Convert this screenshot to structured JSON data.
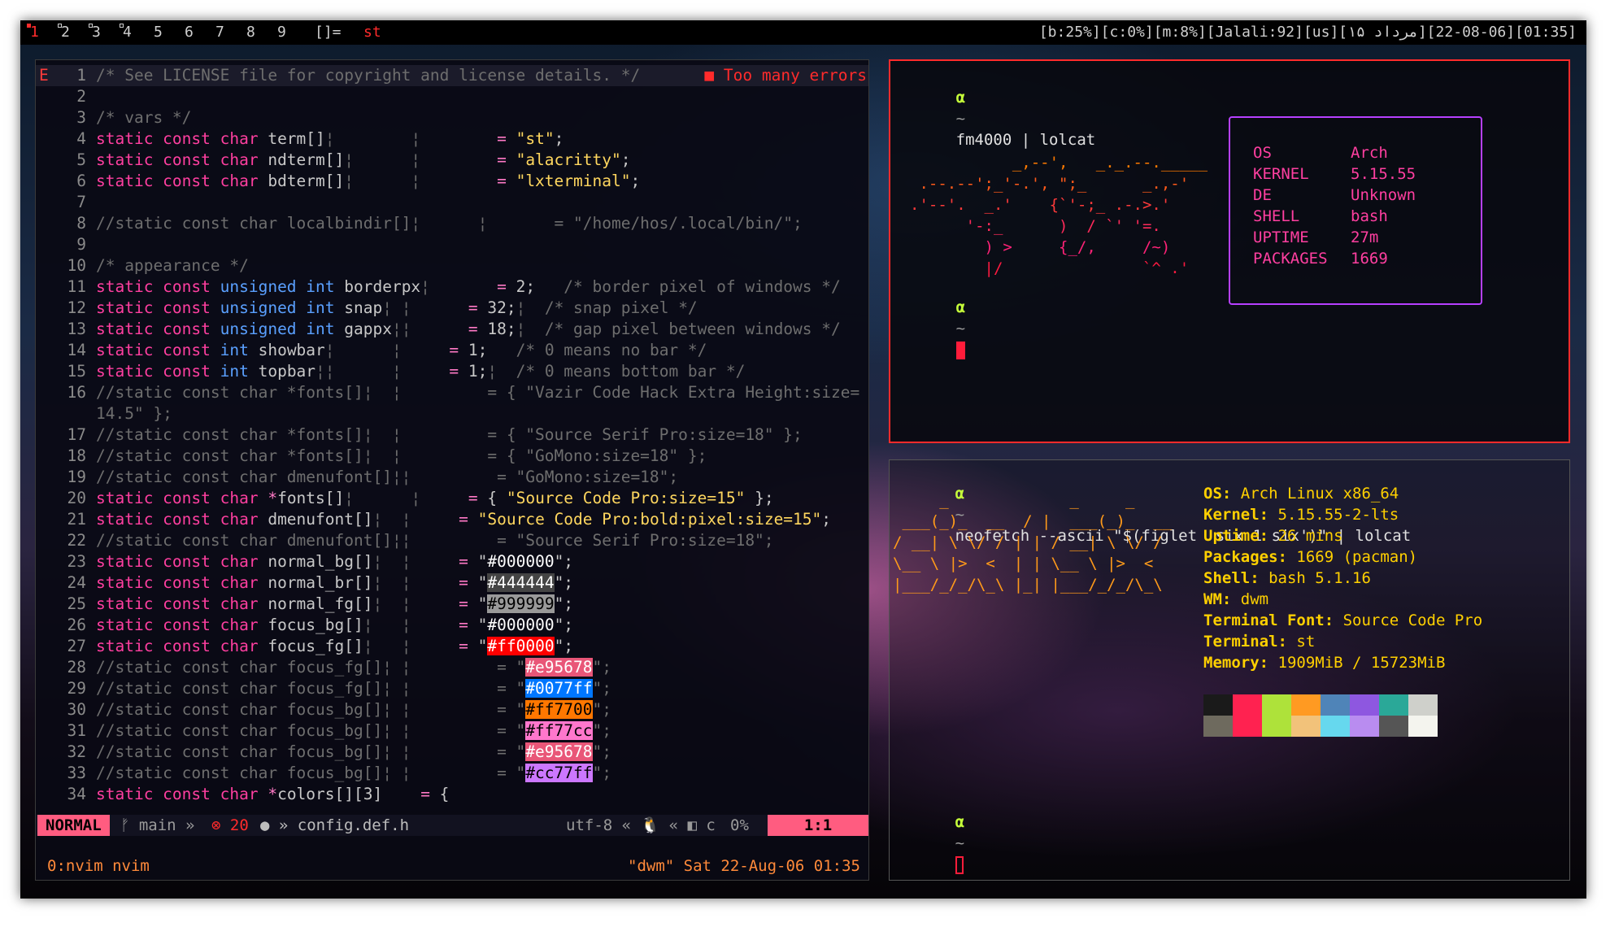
{
  "bar": {
    "tags": [
      "1",
      "2",
      "3",
      "4",
      "5",
      "6",
      "7",
      "8",
      "9"
    ],
    "layout": "[]=",
    "window_title": "st",
    "status": "[b:25%][c:0%][m:8%][Jalali:92][us][۱۵ مرداد][06-08-22][01:35]"
  },
  "vim": {
    "sign": "E",
    "error_text": "■ Too many errors",
    "lines": [
      {
        "n": "1",
        "parts": [
          [
            "cm",
            "/* See LICENSE file for copyright and license details. */"
          ]
        ]
      },
      {
        "n": "2",
        "parts": []
      },
      {
        "n": "3",
        "parts": [
          [
            "cm",
            "/* vars */"
          ]
        ]
      },
      {
        "n": "4",
        "parts": [
          [
            "kw",
            "static const char "
          ],
          [
            "",
            "term[]"
          ],
          [
            "cm",
            "¦        ¦        "
          ],
          [
            "op",
            "= "
          ],
          [
            "str",
            "\"st\""
          ],
          [
            "",
            "; "
          ]
        ]
      },
      {
        "n": "5",
        "parts": [
          [
            "kw",
            "static const char "
          ],
          [
            "",
            "ndterm[]"
          ],
          [
            "cm",
            "¦      ¦        "
          ],
          [
            "op",
            "= "
          ],
          [
            "str",
            "\"alacritty\""
          ],
          [
            "",
            ";"
          ]
        ]
      },
      {
        "n": "6",
        "parts": [
          [
            "kw",
            "static const char "
          ],
          [
            "",
            "bdterm[]"
          ],
          [
            "cm",
            "¦      ¦        "
          ],
          [
            "op",
            "= "
          ],
          [
            "str",
            "\"lxterminal\""
          ],
          [
            "",
            ";"
          ]
        ]
      },
      {
        "n": "7",
        "parts": []
      },
      {
        "n": "8",
        "parts": [
          [
            "cm",
            "//static const char localbindir[]¦      ¦       = \"/home/hos/.local/bin/\";"
          ]
        ]
      },
      {
        "n": "9",
        "parts": []
      },
      {
        "n": "10",
        "parts": [
          [
            "cm",
            "/* appearance */"
          ]
        ]
      },
      {
        "n": "11",
        "parts": [
          [
            "kw",
            "static const "
          ],
          [
            "kt",
            "unsigned int "
          ],
          [
            "",
            "borderpx"
          ],
          [
            "cm",
            "¦       "
          ],
          [
            "op",
            "= "
          ],
          [
            "",
            "2;   "
          ],
          [
            "cm",
            "/* border pixel of windows */"
          ]
        ]
      },
      {
        "n": "12",
        "parts": [
          [
            "kw",
            "static const "
          ],
          [
            "kt",
            "unsigned int "
          ],
          [
            "",
            "snap"
          ],
          [
            "cm",
            "¦ ¦      "
          ],
          [
            "op",
            "= "
          ],
          [
            "",
            "32;"
          ],
          [
            "cm",
            "¦  /* snap pixel */"
          ]
        ]
      },
      {
        "n": "13",
        "parts": [
          [
            "kw",
            "static const "
          ],
          [
            "kt",
            "unsigned int "
          ],
          [
            "",
            "gappx"
          ],
          [
            "cm",
            "¦¦      "
          ],
          [
            "op",
            "= "
          ],
          [
            "",
            "18;"
          ],
          [
            "cm",
            "¦  /* gap pixel between windows */"
          ]
        ]
      },
      {
        "n": "14",
        "parts": [
          [
            "kw",
            "static const "
          ],
          [
            "kt",
            "int "
          ],
          [
            "",
            "showbar"
          ],
          [
            "cm",
            "¦      ¦     "
          ],
          [
            "op",
            "= "
          ],
          [
            "",
            "1;   "
          ],
          [
            "cm",
            "/* 0 means no bar */"
          ]
        ]
      },
      {
        "n": "15",
        "parts": [
          [
            "kw",
            "static const "
          ],
          [
            "kt",
            "int "
          ],
          [
            "",
            "topbar"
          ],
          [
            "cm",
            "¦¦      ¦     "
          ],
          [
            "op",
            "= "
          ],
          [
            "",
            "1;"
          ],
          [
            "cm",
            "¦  /* 0 means bottom bar */"
          ]
        ]
      },
      {
        "n": "16",
        "parts": [
          [
            "cm",
            "//static const char *fonts[]¦  ¦         = { \"Vazir Code Hack Extra Height:size="
          ]
        ]
      },
      {
        "n": "",
        "parts": [
          [
            "cm",
            "14.5\" };"
          ]
        ]
      },
      {
        "n": "17",
        "parts": [
          [
            "cm",
            "//static const char *fonts[]¦  ¦         = { \"Source Serif Pro:size=18\" };"
          ]
        ]
      },
      {
        "n": "18",
        "parts": [
          [
            "cm",
            "//static const char *fonts[]¦  ¦         = { \"GoMono:size=18\" };"
          ]
        ]
      },
      {
        "n": "19",
        "parts": [
          [
            "cm",
            "//static const char dmenufont[]¦¦         = \"GoMono:size=18\";"
          ]
        ]
      },
      {
        "n": "20",
        "parts": [
          [
            "kw",
            "static const char "
          ],
          [
            "op",
            "*"
          ],
          [
            "",
            "fonts[]"
          ],
          [
            "cm",
            "¦      ¦     "
          ],
          [
            "op",
            "= "
          ],
          [
            "",
            "{ "
          ],
          [
            "str",
            "\"Source Code Pro:size=15\""
          ],
          [
            "",
            " };"
          ]
        ]
      },
      {
        "n": "21",
        "parts": [
          [
            "kw",
            "static const char "
          ],
          [
            "",
            "dmenufont[]"
          ],
          [
            "cm",
            "¦  ¦     "
          ],
          [
            "op",
            "= "
          ],
          [
            "str",
            "\"Source Code Pro:bold:pixel:size=15\""
          ],
          [
            "",
            ";"
          ]
        ]
      },
      {
        "n": "22",
        "parts": [
          [
            "cm",
            "//static const char dmenufont[]¦¦         = \"Source Serif Pro:size=18\";"
          ]
        ]
      },
      {
        "n": "23",
        "parts": [
          [
            "kw",
            "static const char "
          ],
          [
            "",
            "normal_bg[]"
          ],
          [
            "cm",
            "¦  ¦     "
          ],
          [
            "op",
            "= "
          ],
          [
            "",
            "\""
          ],
          [
            "swatch",
            "#000000"
          ],
          [
            "",
            "\";"
          ]
        ]
      },
      {
        "n": "24",
        "parts": [
          [
            "kw",
            "static const char "
          ],
          [
            "",
            "normal_br[]"
          ],
          [
            "cm",
            "¦  ¦     "
          ],
          [
            "op",
            "= "
          ],
          [
            "",
            "\""
          ],
          [
            "swatch",
            "#444444"
          ],
          [
            "",
            "\";"
          ]
        ]
      },
      {
        "n": "25",
        "parts": [
          [
            "kw",
            "static const char "
          ],
          [
            "",
            "normal_fg[]"
          ],
          [
            "cm",
            "¦  ¦     "
          ],
          [
            "op",
            "= "
          ],
          [
            "",
            "\""
          ],
          [
            "swatch",
            "#999999"
          ],
          [
            "",
            "\";"
          ]
        ]
      },
      {
        "n": "26",
        "parts": [
          [
            "kw",
            "static const char "
          ],
          [
            "",
            "focus_bg[]"
          ],
          [
            "cm",
            "¦   ¦     "
          ],
          [
            "op",
            "= "
          ],
          [
            "",
            "\""
          ],
          [
            "swatch",
            "#000000"
          ],
          [
            "",
            "\";"
          ]
        ]
      },
      {
        "n": "27",
        "parts": [
          [
            "kw",
            "static const char "
          ],
          [
            "",
            "focus_fg[]"
          ],
          [
            "cm",
            "¦   ¦     "
          ],
          [
            "op",
            "= "
          ],
          [
            "",
            "\""
          ],
          [
            "swatch",
            "#ff0000"
          ],
          [
            "",
            "\";"
          ]
        ]
      },
      {
        "n": "28",
        "parts": [
          [
            "cm",
            "//static const char focus_fg[]¦ ¦         = \""
          ],
          [
            "swatch",
            "#e95678"
          ],
          [
            "cm",
            "\";"
          ]
        ]
      },
      {
        "n": "29",
        "parts": [
          [
            "cm",
            "//static const char focus_fg[]¦ ¦         = \""
          ],
          [
            "swatch",
            "#0077ff"
          ],
          [
            "cm",
            "\";"
          ]
        ]
      },
      {
        "n": "30",
        "parts": [
          [
            "cm",
            "//static const char focus_bg[]¦ ¦         = \""
          ],
          [
            "swatch",
            "#ff7700"
          ],
          [
            "cm",
            "\";"
          ]
        ]
      },
      {
        "n": "31",
        "parts": [
          [
            "cm",
            "//static const char focus_bg[]¦ ¦         = \""
          ],
          [
            "swatch",
            "#ff77cc"
          ],
          [
            "cm",
            "\";"
          ]
        ]
      },
      {
        "n": "32",
        "parts": [
          [
            "cm",
            "//static const char focus_bg[]¦ ¦         = \""
          ],
          [
            "swatch",
            "#e95678"
          ],
          [
            "cm",
            "\";"
          ]
        ]
      },
      {
        "n": "33",
        "parts": [
          [
            "cm",
            "//static const char focus_bg[]¦ ¦         = \""
          ],
          [
            "swatch",
            "#cc77ff"
          ],
          [
            "cm",
            "\";"
          ]
        ]
      },
      {
        "n": "34",
        "parts": [
          [
            "kw",
            "static const char "
          ],
          [
            "op",
            "*"
          ],
          [
            "",
            "colors[][3]    "
          ],
          [
            "op",
            "= "
          ],
          [
            "",
            "{"
          ]
        ]
      }
    ],
    "swatch_colors": {
      "#000000": [
        "#000000",
        "#ffffff"
      ],
      "#444444": [
        "#444444",
        "#ffffff"
      ],
      "#999999": [
        "#999999",
        "#000000"
      ],
      "#ff0000": [
        "#ff0000",
        "#ffffff"
      ],
      "#e95678": [
        "#e95678",
        "#ffffff"
      ],
      "#0077ff": [
        "#0077ff",
        "#ffffff"
      ],
      "#ff7700": [
        "#ff7700",
        "#000000"
      ],
      "#ff77cc": [
        "#ff77cc",
        "#000000"
      ],
      "#cc77ff": [
        "#cc77ff",
        "#000000"
      ]
    },
    "status": {
      "mode": "NORMAL",
      "branch": "ᚠ main »",
      "errors": "⊗ 20",
      "file": "● » config.def.h",
      "encoding": "utf-8 « 🐧 « ◧ c",
      "percent": "0%",
      "position": "1:1"
    },
    "tmux": {
      "left": "0:nvim nvim",
      "right": "\"dwm\" Sat 22-Aug-06 01:35"
    }
  },
  "term1": {
    "prompt_symbol": "α",
    "prompt_dir": "~",
    "command": "fm4000 | lolcat",
    "ascii_art": "           _,--',   _._.--._____\n .--.--';_'-.', \";_      _.,-'\n.'--'.  _.'    {`'-;_ .-.>.'\n      '-:_      )  / `' '=.\n        ) >     {_/,     /~)\n        |/               `^ .'",
    "fetch": [
      {
        "k": "OS",
        "v": "Arch"
      },
      {
        "k": "KERNEL",
        "v": "5.15.55"
      },
      {
        "k": "DE",
        "v": "Unknown"
      },
      {
        "k": "SHELL",
        "v": "bash"
      },
      {
        "k": "UPTIME",
        "v": "27m"
      },
      {
        "k": "PACKAGES",
        "v": "1669"
      }
    ]
  },
  "term2": {
    "prompt_symbol": "α",
    "prompt_dir": "~",
    "command": "neofetch --ascii \"$(figlet 'six 1 six')\" | lolcat",
    "ascii_art": "     _             _     _\n ___(_)_  __  / |  ___(_)_  __\n/ __| \\ \\/ / | | / __| \\ \\/ /\n\\__ \\ |>  <  | | \\__ \\ |>  <\n|___/_/_/\\_\\ |_| |___/_/_/\\_\\",
    "info": [
      {
        "k": "OS:",
        "v": " Arch Linux x86_64"
      },
      {
        "k": "Kernel:",
        "v": " 5.15.55-2-lts"
      },
      {
        "k": "Uptime:",
        "v": " 26 mins"
      },
      {
        "k": "Packages:",
        "v": " 1669 (pacman)"
      },
      {
        "k": "Shell:",
        "v": " bash 5.1.16"
      },
      {
        "k": "WM:",
        "v": " dwm"
      },
      {
        "k": "Terminal Font:",
        "v": " Source Code Pro"
      },
      {
        "k": "Terminal:",
        "v": " st"
      },
      {
        "k": "Memory:",
        "v": " 1909MiB / 15723MiB"
      }
    ],
    "palette": [
      "#1a1a1a",
      "#ff2250",
      "#aee23a",
      "#ff9a22",
      "#4f84b8",
      "#8e57e0",
      "#2aa898",
      "#cfd0cb",
      "#6e6a5e",
      "#ff2250",
      "#aee23a",
      "#f2c27a",
      "#66d8ee",
      "#b98cf0",
      "#555555",
      "#f4f4ee"
    ]
  }
}
